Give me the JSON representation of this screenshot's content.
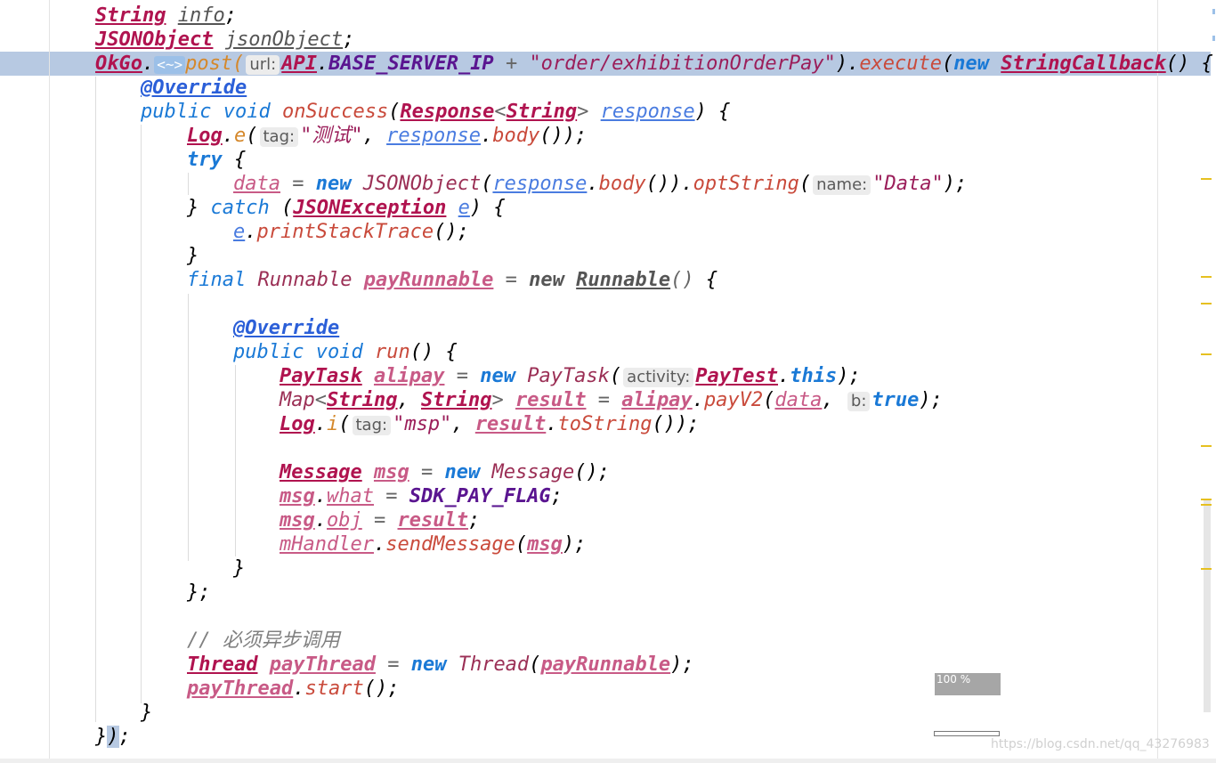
{
  "editor": {
    "zoom_label": "100 %",
    "watermark": "https://blog.csdn.net/qq_43276983",
    "hints": {
      "url": "url:",
      "tag": "tag:",
      "name": "name:",
      "activity": "activity:",
      "b": "b:"
    },
    "folded_generic": "<~>",
    "strings": {
      "order_path": "\"order/exhibitionOrderPay\"",
      "test": "\"测试\"",
      "data_key": "\"Data\"",
      "msp": "\"msp\""
    },
    "comment": "// 必须异步调用",
    "identifiers": {
      "String": "String",
      "info": "info",
      "JSONObject": "JSONObject",
      "jsonObject": "jsonObject",
      "OkGo": "OkGo",
      "post": "post",
      "API": "API",
      "BASE_SERVER_IP": "BASE_SERVER_IP",
      "execute": "execute",
      "new": "new",
      "StringCallback": "StringCallback",
      "Override": "@Override",
      "public": "public",
      "void": "void",
      "onSuccess": "onSuccess",
      "Response": "Response",
      "response": "response",
      "Log": "Log",
      "e_method": "e",
      "body": "body",
      "try": "try",
      "data": "data",
      "optString": "optString",
      "catch": "catch",
      "JSONException": "JSONException",
      "e_var": "e",
      "printStackTrace": "printStackTrace",
      "final": "final",
      "Runnable": "Runnable",
      "payRunnable": "payRunnable",
      "run": "run",
      "PayTask": "PayTask",
      "alipay": "alipay",
      "PayTest": "PayTest",
      "this": "this",
      "Map": "Map",
      "result": "result",
      "payV2": "payV2",
      "true": "true",
      "i_method": "i",
      "toString": "toString",
      "Message": "Message",
      "msg": "msg",
      "what": "what",
      "SDK_PAY_FLAG": "SDK_PAY_FLAG",
      "obj": "obj",
      "mHandler": "mHandler",
      "sendMessage": "sendMessage",
      "Thread": "Thread",
      "payThread": "payThread",
      "start": "start"
    }
  }
}
